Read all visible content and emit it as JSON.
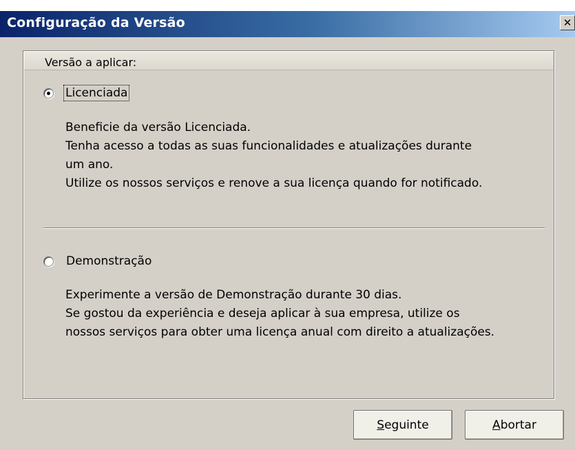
{
  "window": {
    "title": "Configuração da Versão",
    "close_glyph": "✕"
  },
  "group": {
    "title": "Versão a aplicar:"
  },
  "options": {
    "licensed": {
      "label": "Licenciada",
      "selected": true,
      "description": [
        "Beneficie da versão Licenciada.",
        "Tenha acesso a todas as suas funcionalidades e atualizações durante",
        "um ano.",
        "Utilize os nossos serviços e renove a sua licença quando for notificado."
      ]
    },
    "demo": {
      "label": "Demonstração",
      "selected": false,
      "description": [
        "Experimente a versão de Demonstração durante 30 dias.",
        "Se gostou da experiência e deseja aplicar à sua empresa, utilize os",
        "nossos serviços para obter uma licença anual com direito a atualizações."
      ]
    }
  },
  "buttons": {
    "next": {
      "mnemonic": "S",
      "rest": "eguinte"
    },
    "abort": {
      "mnemonic": "A",
      "rest": "bortar"
    }
  },
  "colors": {
    "titlebar_start": "#0a246a",
    "titlebar_end": "#a6caf0",
    "dialog_bg": "#d4d0c8"
  }
}
